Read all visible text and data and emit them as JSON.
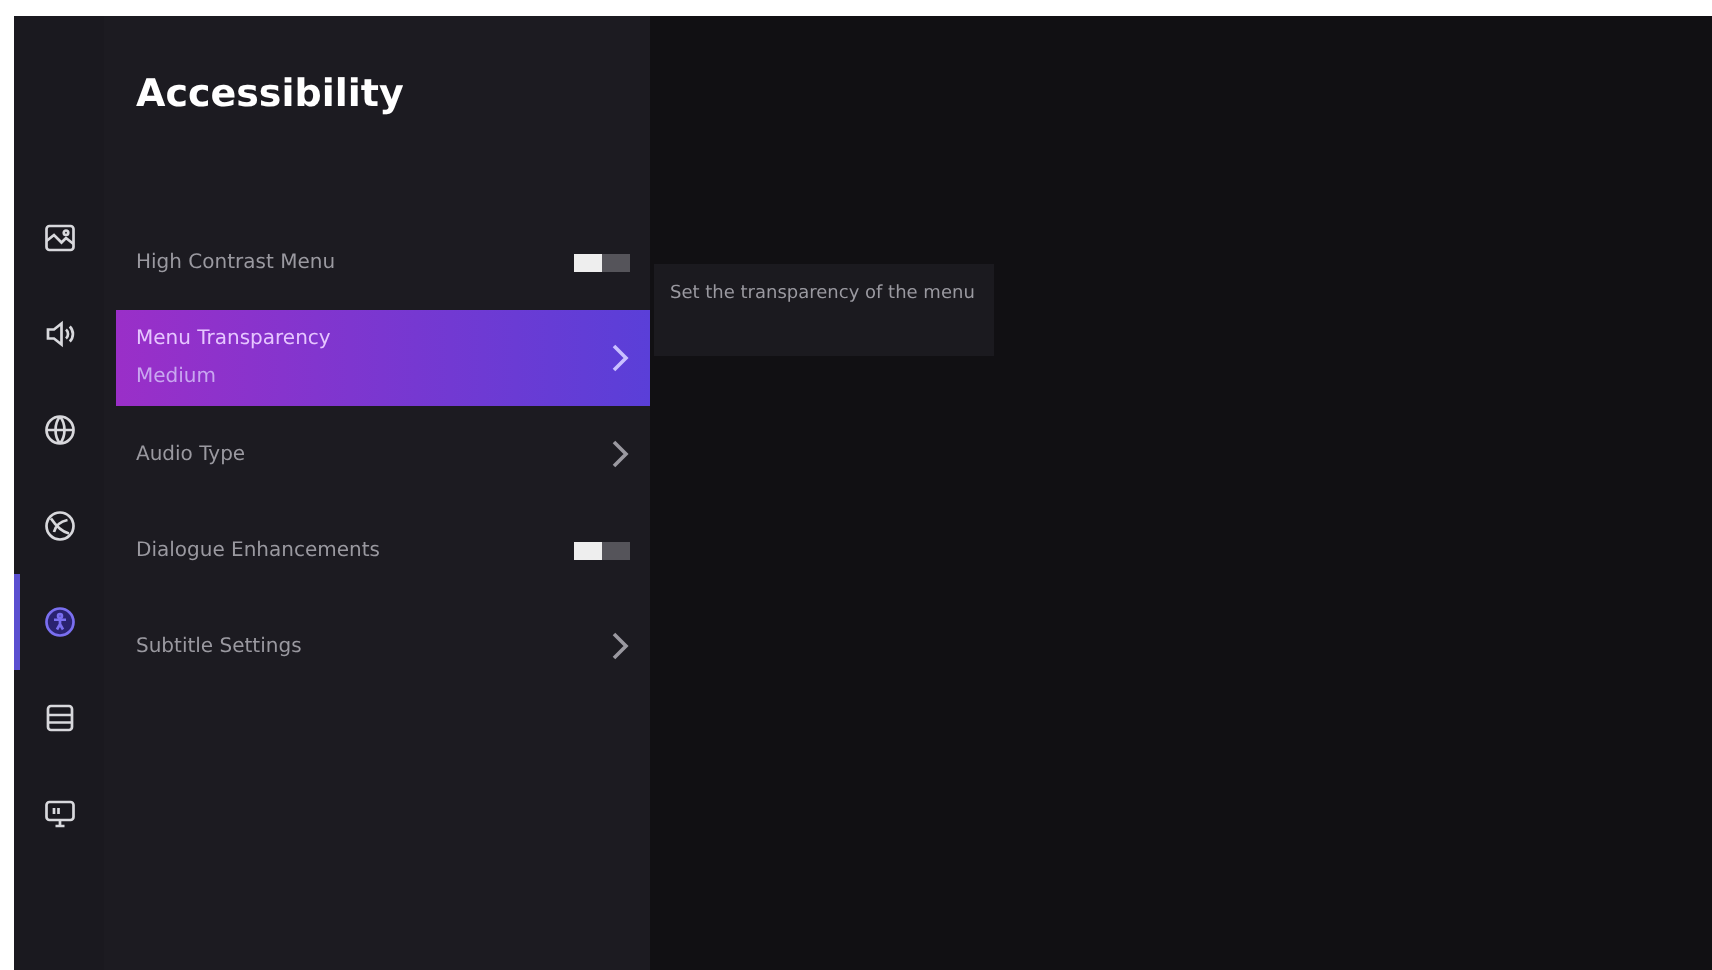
{
  "sidebar": {
    "items": [
      {
        "kind": "picture",
        "selected": false
      },
      {
        "kind": "sound",
        "selected": false
      },
      {
        "kind": "network",
        "selected": false
      },
      {
        "kind": "privacy",
        "selected": false
      },
      {
        "kind": "accessibility",
        "selected": true
      },
      {
        "kind": "system",
        "selected": false
      },
      {
        "kind": "display",
        "selected": false
      }
    ]
  },
  "menu": {
    "title": "Accessibility",
    "items": [
      {
        "kind": "toggle",
        "label": "High Contrast Menu",
        "on": false,
        "selected": false
      },
      {
        "kind": "submenu",
        "label": "Menu Transparency",
        "value": "Medium",
        "selected": true
      },
      {
        "kind": "submenu",
        "label": "Audio Type",
        "selected": false
      },
      {
        "kind": "toggle",
        "label": "Dialogue Enhancements",
        "on": false,
        "selected": false
      },
      {
        "kind": "submenu",
        "label": "Subtitle Settings",
        "selected": false
      }
    ]
  },
  "description": "Set the transparency of the menu"
}
